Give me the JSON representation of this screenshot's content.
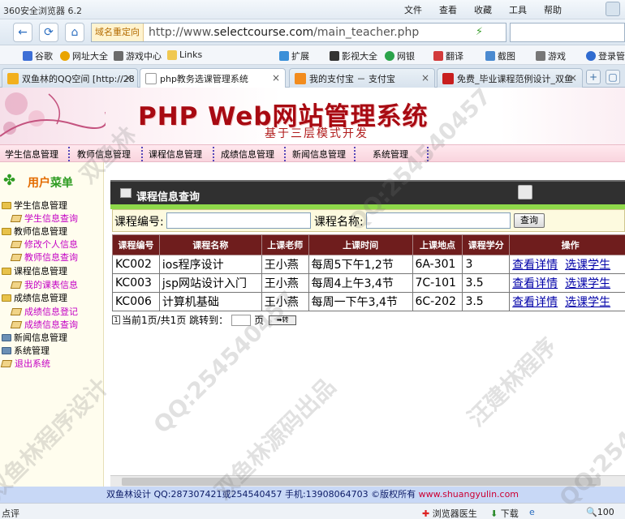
{
  "browser": {
    "title": "360安全浏览器 6.2",
    "menus": [
      "文件",
      "查看",
      "收藏",
      "工具",
      "帮助"
    ],
    "redirect_badge": "域名重定向",
    "url_prefix": "http://www.",
    "url_domain": "selectcourse.com",
    "url_path": "/main_teacher.php"
  },
  "bookmarks": [
    "谷歌",
    "网址大全",
    "游戏中心",
    "Links",
    "扩展",
    "影视大全",
    "网银",
    "翻译",
    "截图",
    "游戏",
    "登录管"
  ],
  "tabs": [
    {
      "label": "双鱼林的QQ空间 [http://28"
    },
    {
      "label": "php教务选课管理系统",
      "active": true
    },
    {
      "label": "我的支付宝 － 支付宝"
    },
    {
      "label": "免费_毕业课程范例设计_双鱼"
    }
  ],
  "site": {
    "banner_title": "PHP Web网站管理系统",
    "banner_sub": "基于三层模式开发"
  },
  "topnav": [
    "学生信息管理",
    "教师信息管理",
    "课程信息管理",
    "成绩信息管理",
    "新闻信息管理",
    "系统管理"
  ],
  "sidebar": {
    "heading_prefix": "用户",
    "heading_suffix": "菜单",
    "items": [
      {
        "label": "学生信息管理",
        "level": 0
      },
      {
        "label": "学生信息查询",
        "level": 1
      },
      {
        "label": "教师信息管理",
        "level": 0
      },
      {
        "label": "修改个人信息",
        "level": 1
      },
      {
        "label": "教师信息查询",
        "level": 1
      },
      {
        "label": "课程信息管理",
        "level": 0
      },
      {
        "label": "我的课表信息",
        "level": 1
      },
      {
        "label": "成绩信息管理",
        "level": 0
      },
      {
        "label": "成绩信息登记",
        "level": 1
      },
      {
        "label": "成绩信息查询",
        "level": 1
      },
      {
        "label": "新闻信息管理",
        "level": 0
      },
      {
        "label": "系统管理",
        "level": 0
      },
      {
        "label": "退出系统",
        "level": 0
      }
    ]
  },
  "main": {
    "panel_title": "课程信息查询",
    "search": {
      "course_no_label": "课程编号:",
      "course_no_value": "",
      "course_name_label": "课程名称:",
      "course_name_value": "",
      "query_button": "查询"
    },
    "columns": [
      "课程编号",
      "课程名称",
      "上课老师",
      "上课时间",
      "上课地点",
      "课程学分",
      "操作"
    ],
    "rows": [
      {
        "no": "KC002",
        "name": "ios程序设计",
        "teacher": "王小燕",
        "time": "每周5下午1,2节",
        "place": "6A-301",
        "credit": "3",
        "detail": "查看详情",
        "select": "选课学生"
      },
      {
        "no": "KC003",
        "name": "jsp网站设计入门",
        "teacher": "王小燕",
        "time": "每周4上午3,4节",
        "place": "7C-101",
        "credit": "3.5",
        "detail": "查看详情",
        "select": "选课学生"
      },
      {
        "no": "KC006",
        "name": "计算机基础",
        "teacher": "王小燕",
        "time": "每周一下午3,4节",
        "place": "6C-202",
        "credit": "3.5",
        "detail": "查看详情",
        "select": "选课学生"
      }
    ],
    "pager": {
      "page_icon": "1",
      "text": "当前1页/共1页 跳转到：",
      "unit": "页",
      "go": "➡转"
    }
  },
  "footer": {
    "text": "双鱼林设计 QQ:287307421或254540457 手机:13908064703 ©版权所有 ",
    "site": "www.shuangyulin.com"
  },
  "statusbar": {
    "left": "点评",
    "doctor": "浏览器医生",
    "download": "下载",
    "zoom": "100"
  },
  "watermarks": [
    "双鱼林程序设计",
    "QQ:254540457",
    "双鱼林源码出品",
    "汪建林程序",
    "双鱼林"
  ]
}
